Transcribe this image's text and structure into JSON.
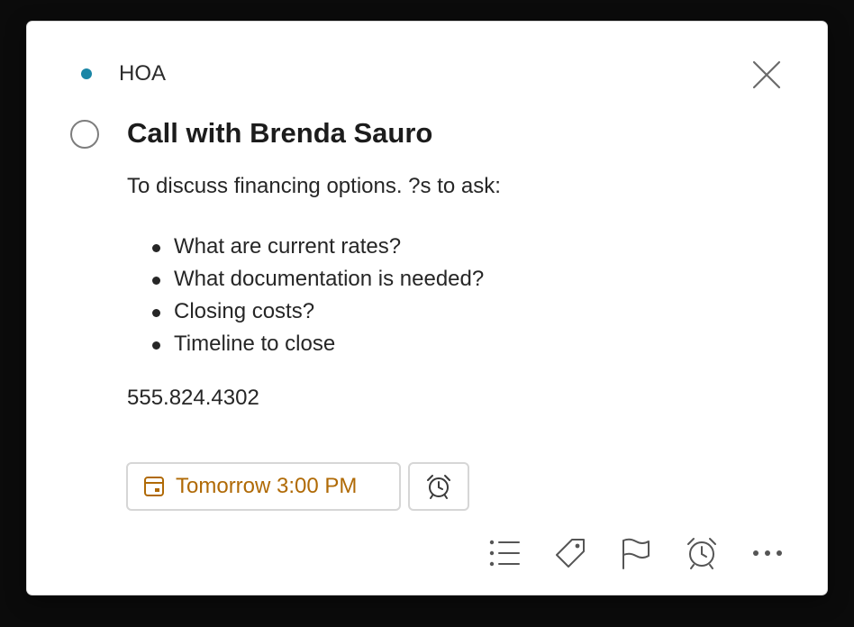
{
  "task": {
    "list_name": "HOA",
    "list_color": "#1a86a6",
    "title": "Call with Brenda Sauro",
    "notes": {
      "intro": "To discuss financing options. ?s to ask:",
      "bullets": [
        "What are current rates?",
        "What documentation is needed?",
        "Closing costs?",
        "Timeline to close"
      ],
      "phone": "555.824.4302"
    },
    "due": {
      "label": "Tomorrow 3:00 PM",
      "icon": "calendar-icon",
      "color": "#b06a06"
    },
    "reminder_icon": "alarm-clock-icon"
  },
  "header": {
    "close_icon": "close-icon"
  },
  "toolbar": {
    "icons": [
      "checklist-icon",
      "tag-icon",
      "flag-icon",
      "alarm-clock-icon",
      "more-icon"
    ]
  }
}
